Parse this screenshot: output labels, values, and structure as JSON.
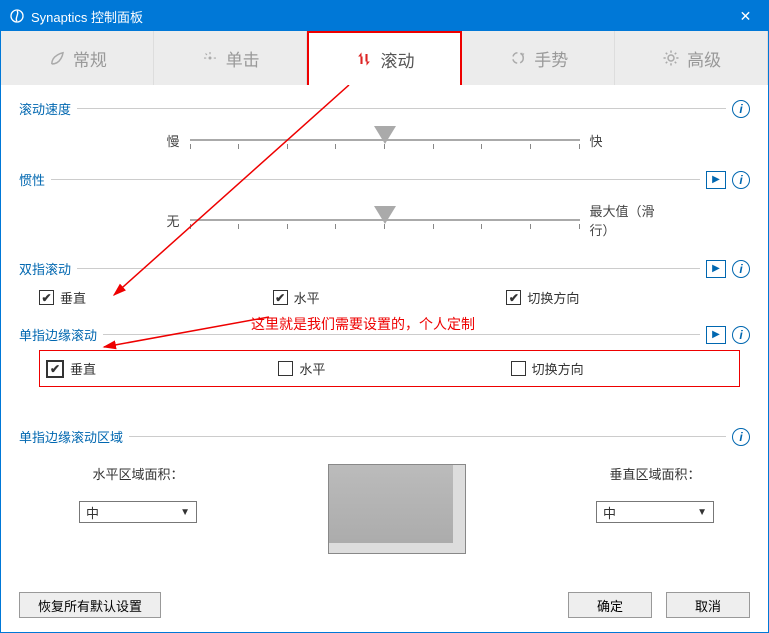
{
  "window": {
    "title": "Synaptics 控制面板"
  },
  "tabs": {
    "general": "常规",
    "click": "单击",
    "scroll": "滚动",
    "gesture": "手势",
    "advanced": "高级"
  },
  "sections": {
    "scroll_speed": {
      "title": "滚动速度",
      "left": "慢",
      "right": "快"
    },
    "inertia": {
      "title": "惯性",
      "left": "无",
      "right": "最大值（滑行）"
    },
    "two_finger": {
      "title": "双指滚动",
      "vertical": "垂直",
      "horizontal": "水平",
      "switch_dir": "切换方向"
    },
    "edge": {
      "title": "单指边缘滚动",
      "vertical": "垂直",
      "horizontal": "水平",
      "switch_dir": "切换方向"
    },
    "edge_area": {
      "title": "单指边缘滚动区域",
      "h_label": "水平区域面积：",
      "v_label": "垂直区域面积：",
      "h_value": "中",
      "v_value": "中"
    }
  },
  "annotation": "这里就是我们需要设置的，个人定制",
  "footer": {
    "restore": "恢复所有默认设置",
    "ok": "确定",
    "cancel": "取消"
  },
  "checks": {
    "two_v": true,
    "two_h": true,
    "two_s": true,
    "edge_v": true,
    "edge_h": false,
    "edge_s": false
  }
}
